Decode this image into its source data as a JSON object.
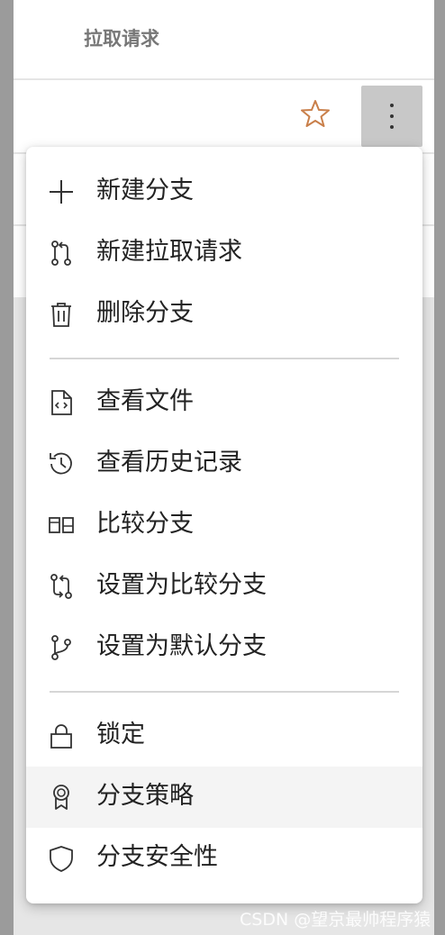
{
  "header": {
    "tab_label": "拉取请求"
  },
  "branch_row": {
    "star_icon": "star-outline-icon",
    "more_icon": "more-vertical-icon",
    "star_color": "#c97f4a"
  },
  "menu": {
    "items": [
      {
        "label": "新建分支",
        "icon": "plus-icon"
      },
      {
        "label": "新建拉取请求",
        "icon": "pull-request-icon"
      },
      {
        "label": "删除分支",
        "icon": "trash-icon"
      },
      {
        "label": "查看文件",
        "icon": "code-file-icon"
      },
      {
        "label": "查看历史记录",
        "icon": "history-icon"
      },
      {
        "label": "比较分支",
        "icon": "compare-icon"
      },
      {
        "label": "设置为比较分支",
        "icon": "swap-branch-icon"
      },
      {
        "label": "设置为默认分支",
        "icon": "branch-icon"
      },
      {
        "label": "锁定",
        "icon": "lock-icon"
      },
      {
        "label": "分支策略",
        "icon": "badge-icon"
      },
      {
        "label": "分支安全性",
        "icon": "shield-icon"
      }
    ]
  },
  "watermark": "CSDN @望京最帅程序猿"
}
